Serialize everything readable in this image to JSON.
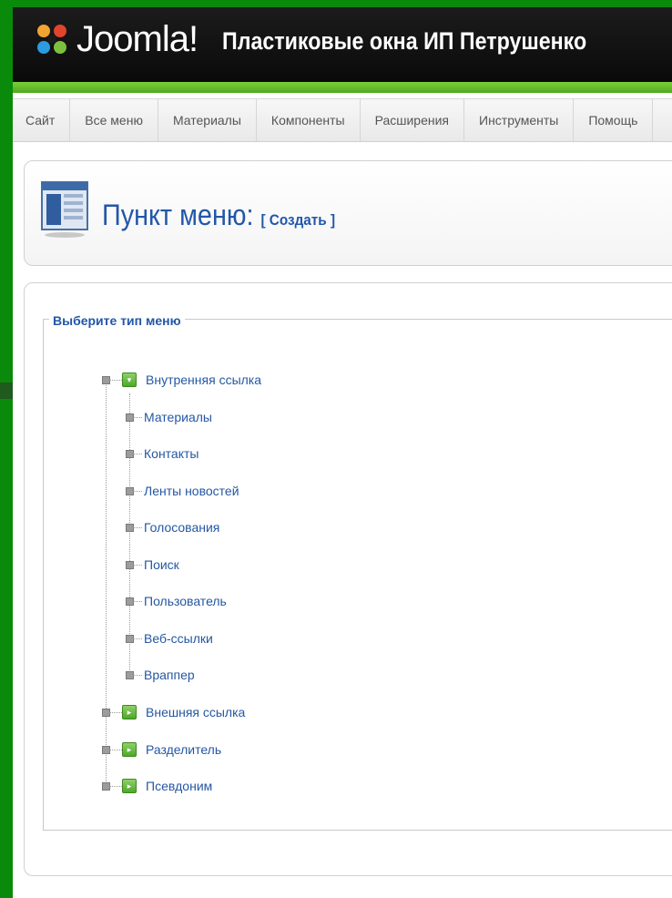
{
  "header": {
    "logo_text": "Joomla!",
    "site_name": "Пластиковые окна ИП Петрушенко"
  },
  "menubar": {
    "items": [
      {
        "label": "Сайт"
      },
      {
        "label": "Все меню"
      },
      {
        "label": "Материалы"
      },
      {
        "label": "Компоненты"
      },
      {
        "label": "Расширения"
      },
      {
        "label": "Инструменты"
      },
      {
        "label": "Помощь"
      }
    ]
  },
  "title": {
    "main": "Пункт меню:",
    "sub": "[ Создать ]"
  },
  "fieldset": {
    "legend": "Выберите тип меню"
  },
  "tree": {
    "internal": {
      "label": "Внутренняя ссылка",
      "children": [
        {
          "label": "Материалы"
        },
        {
          "label": "Контакты"
        },
        {
          "label": "Ленты новостей"
        },
        {
          "label": "Голосования"
        },
        {
          "label": "Поиск"
        },
        {
          "label": "Пользователь"
        },
        {
          "label": "Веб-ссылки"
        },
        {
          "label": "Враппер"
        }
      ]
    },
    "external": {
      "label": "Внешняя ссылка"
    },
    "separator": {
      "label": "Разделитель"
    },
    "alias": {
      "label": "Псевдоним"
    }
  },
  "colors": {
    "outer_green": "#0a8a0a",
    "header_bar_green": "#5fb82a",
    "link_blue": "#2257a8",
    "folder_green": "#4fa62a"
  }
}
